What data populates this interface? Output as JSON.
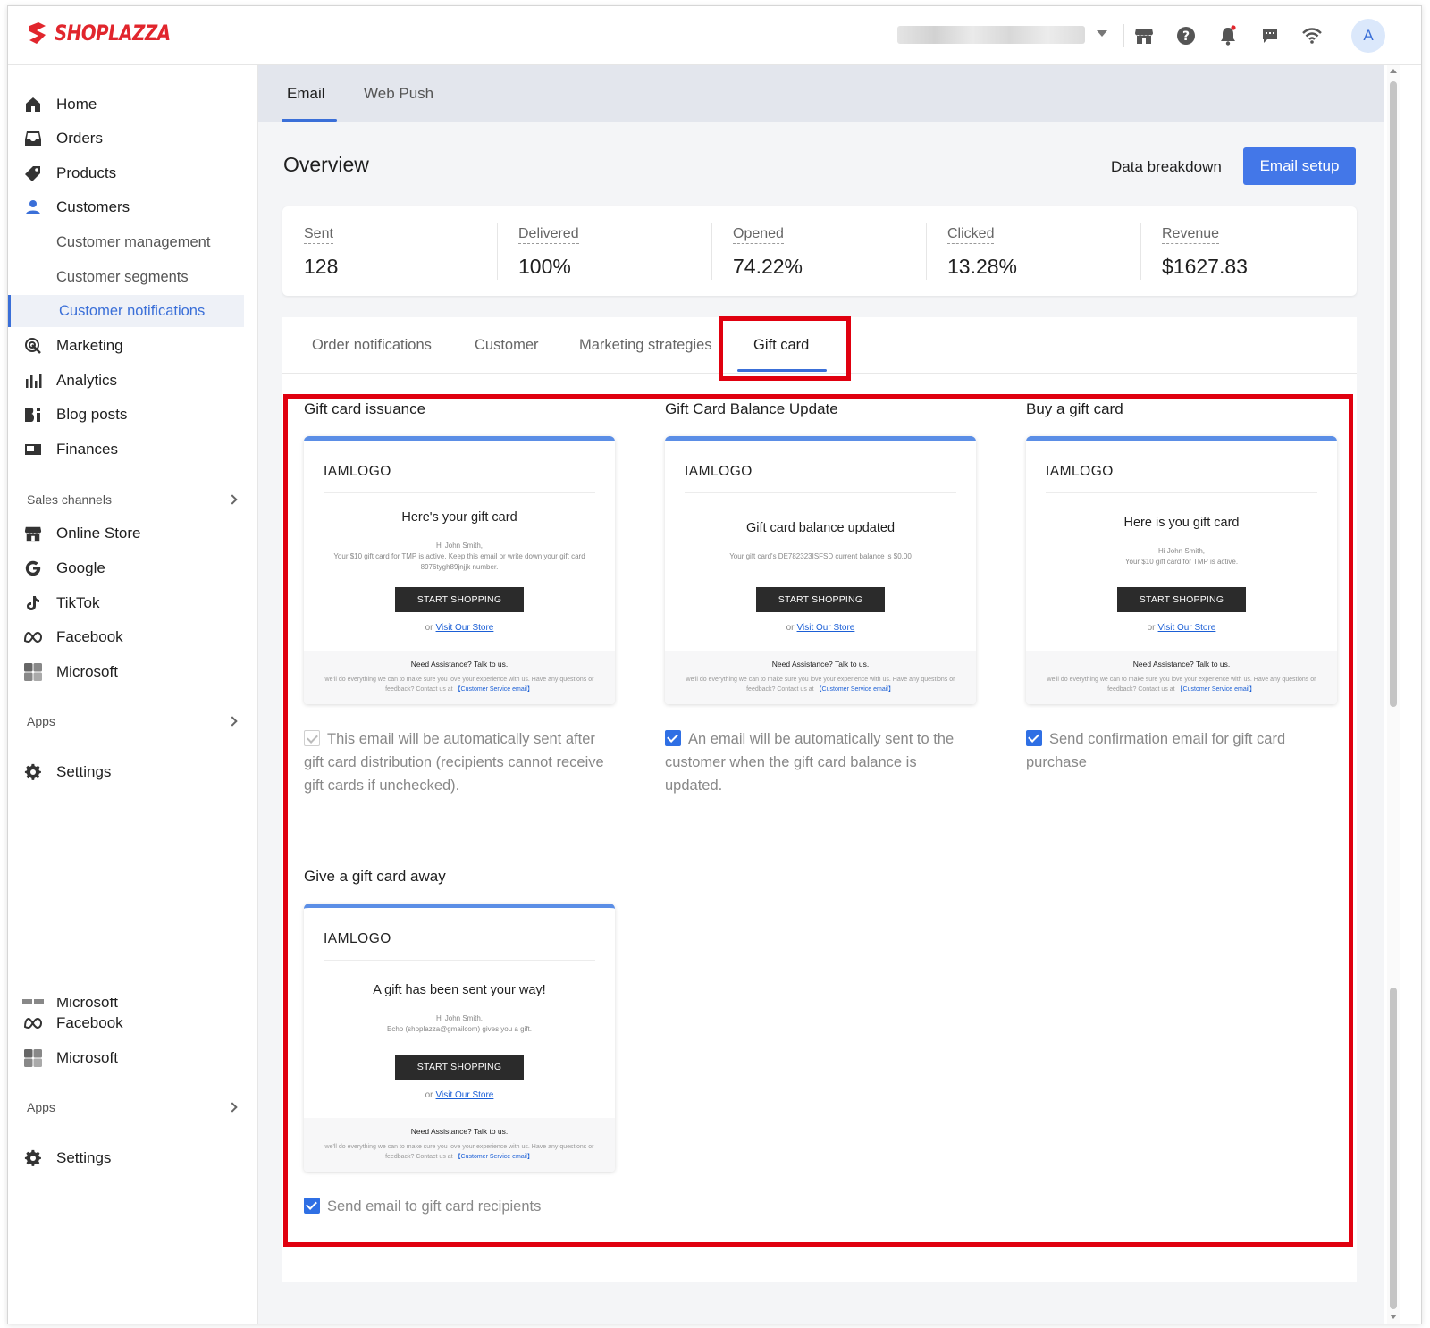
{
  "brand": {
    "name": "SHOPLAZZA",
    "color": "#e1262d"
  },
  "header": {
    "avatar_letter": "A",
    "icons": [
      "storefront-icon",
      "help-icon",
      "bell-icon",
      "message-icon",
      "wifi-icon"
    ]
  },
  "sidebar": {
    "items": [
      {
        "label": "Home",
        "icon": "home-icon"
      },
      {
        "label": "Orders",
        "icon": "inbox-icon"
      },
      {
        "label": "Products",
        "icon": "tag-icon"
      },
      {
        "label": "Customers",
        "icon": "person-icon"
      },
      {
        "label": "Marketing",
        "icon": "target-icon"
      },
      {
        "label": "Analytics",
        "icon": "bar-chart-icon"
      },
      {
        "label": "Blog posts",
        "icon": "blog-icon"
      },
      {
        "label": "Finances",
        "icon": "wallet-icon"
      }
    ],
    "customers_sub": [
      "Customer management",
      "Customer segments",
      "Customer notifications"
    ],
    "sales_channels_label": "Sales channels",
    "channels": [
      {
        "label": "Online Store",
        "icon": "storefront-icon"
      },
      {
        "label": "Google",
        "icon": "google-icon"
      },
      {
        "label": "TikTok",
        "icon": "tiktok-icon"
      },
      {
        "label": "Facebook",
        "icon": "meta-icon"
      },
      {
        "label": "Microsoft",
        "icon": "microsoft-icon"
      }
    ],
    "apps_label": "Apps",
    "settings_label": "Settings",
    "duplicate": {
      "cut_label": "Microsoft",
      "facebook": "Facebook",
      "microsoft": "Microsoft",
      "apps": "Apps",
      "settings": "Settings"
    }
  },
  "top_tabs": [
    "Email",
    "Web Push"
  ],
  "overview": {
    "title": "Overview",
    "data_breakdown": "Data breakdown",
    "email_setup": "Email setup",
    "accent": "#4377e8"
  },
  "stats": [
    {
      "label": "Sent",
      "value": "128"
    },
    {
      "label": "Delivered",
      "value": "100%"
    },
    {
      "label": "Opened",
      "value": "74.22%"
    },
    {
      "label": "Clicked",
      "value": "13.28%"
    },
    {
      "label": "Revenue",
      "value": "$1627.83"
    }
  ],
  "sub_tabs": [
    "Order notifications",
    "Customer",
    "Marketing strategies",
    "Gift card"
  ],
  "templates": [
    {
      "title": "Gift card issuance",
      "logo": "IAMLOGO",
      "heading": "Here's your gift card",
      "body1": "Hi John Smith,",
      "body2": "Your $10 gift card for TMP is active. Keep this email or write down your gift card 8976tygh89jnjjk number.",
      "button": "START SHOPPING",
      "or": "or",
      "link": "Visit Our Store",
      "footer_head": "Need Assistance? Talk to us.",
      "footer_text": "we'll do everything we can to make sure you love your experience with us. Have any questions or feedback? Contact us at",
      "footer_link": "【Customer Service email】",
      "checked": false,
      "check_text": "This email will be automatically sent after gift card distribution (recipients cannot receive gift cards if unchecked)."
    },
    {
      "title": "Gift Card Balance Update",
      "logo": "IAMLOGO",
      "heading": "Gift card balance updated",
      "body1": "",
      "body2": "Your gift card's DE782323ISFSD current balance is $0.00",
      "button": "START SHOPPING",
      "or": "or",
      "link": "Visit Our Store",
      "footer_head": "Need Assistance? Talk to us.",
      "footer_text": "we'll do everything we can to make sure you love your experience with us. Have any questions or feedback? Contact us at",
      "footer_link": "【Customer Service email】",
      "checked": true,
      "check_text": "An email will be automatically sent to the customer when the gift card balance is updated."
    },
    {
      "title": "Buy a gift card",
      "logo": "IAMLOGO",
      "heading": "Here is you gift card",
      "body1": "Hi John Smith,",
      "body2": "Your $10 gift card for TMP is active.",
      "button": "START SHOPPING",
      "or": "or",
      "link": "Visit Our Store",
      "footer_head": "Need Assistance? Talk to us.",
      "footer_text": "we'll do everything we can to make sure you love your experience with us. Have any questions or feedback? Contact us at",
      "footer_link": "【Customer Service email】",
      "checked": true,
      "check_text": "Send confirmation email for gift card purchase"
    },
    {
      "title": "Give a gift card away",
      "logo": "IAMLOGO",
      "heading": "A gift has been sent your way!",
      "body1": "Hi John Smith,",
      "body2": "Echo (shoplazza@gmailcom) gives you a gift.",
      "button": "START SHOPPING",
      "or": "or",
      "link": "Visit Our Store",
      "footer_head": "Need Assistance? Talk to us.",
      "footer_text": "we'll do everything we can to make sure you love your experience with us. Have any questions or feedback? Contact us at",
      "footer_link": "【Customer Service email】",
      "checked": true,
      "check_text": "Send email to gift card recipients"
    }
  ],
  "highlight_color": "#e0000f"
}
